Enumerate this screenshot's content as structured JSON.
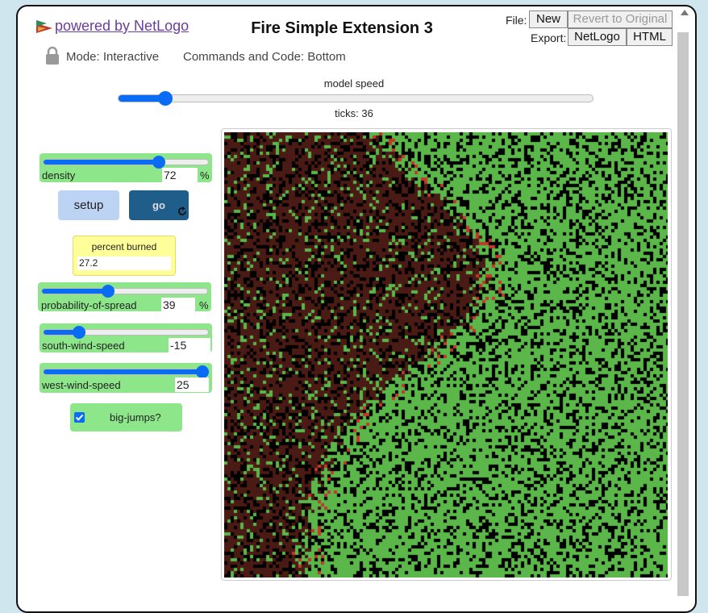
{
  "header": {
    "powered_by": "powered by NetLogo",
    "title": "Fire Simple Extension 3",
    "file_label": "File:",
    "export_label": "Export:",
    "new_button": "New",
    "revert_button": "Revert to Original",
    "netlogo_button": "NetLogo",
    "html_button": "HTML",
    "mode": "Mode: Interactive",
    "commands": "Commands and Code: Bottom"
  },
  "speed": {
    "label": "model speed",
    "value_fraction": 0.1,
    "ticks_text": "ticks: 36"
  },
  "widgets": {
    "density": {
      "label": "density",
      "value": "72",
      "unit": "%",
      "fraction": 0.72
    },
    "setup_label": "setup",
    "go_label": "go",
    "monitor": {
      "label": "percent burned",
      "value": "27.2"
    },
    "spread": {
      "label": "probability-of-spread",
      "value": "39",
      "unit": "%",
      "fraction": 0.39
    },
    "south_wind": {
      "label": "south-wind-speed",
      "value": "-15",
      "fraction": 0.2
    },
    "west_wind": {
      "label": "west-wind-speed",
      "value": "25",
      "fraction": 1.0
    },
    "big_jumps": {
      "label": "big-jumps?",
      "checked": true
    }
  },
  "colors": {
    "tree_green": "#5cb74b",
    "burned": "#4a1a14",
    "empty": "#000000",
    "fire_red": "#c0392b",
    "accent": "#0a6cf5",
    "widget_green": "#8ee68b"
  },
  "icons": [
    "lock-icon",
    "netlogo-logo-icon",
    "forever-icon",
    "checkbox-checked-icon"
  ]
}
